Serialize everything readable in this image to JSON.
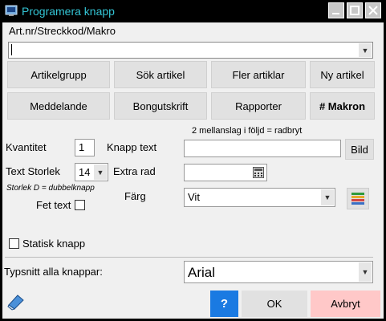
{
  "window": {
    "title": "Programera knapp"
  },
  "article": {
    "label": "Art.nr/Streckkod/Makro",
    "value": ""
  },
  "buttons_row1": [
    "Artikelgrupp",
    "Sök artikel",
    "Fler artiklar",
    "Ny artikel"
  ],
  "buttons_row2": [
    "Meddelande",
    "Bongutskrift",
    "Rapporter",
    "# Makron"
  ],
  "hint": "2 mellanslag i följd = radbryt",
  "quantity": {
    "label": "Kvantitet",
    "value": "1"
  },
  "button_text": {
    "label": "Knapp text",
    "value": "",
    "bild_label": "Bild"
  },
  "text_size": {
    "label": "Text Storlek",
    "value": "14",
    "note": "Storlek D = dubbelknapp"
  },
  "extra_row": {
    "label": "Extra rad",
    "value": ""
  },
  "bold_text": {
    "label": "Fet text",
    "checked": false
  },
  "color": {
    "label": "Färg",
    "value": "Vit"
  },
  "static_button": {
    "label": "Statisk knapp",
    "checked": false
  },
  "font_all": {
    "label": "Typsnitt alla knappar:",
    "value": "Arial"
  },
  "footer": {
    "help": "?",
    "ok": "OK",
    "cancel": "Avbryt"
  }
}
